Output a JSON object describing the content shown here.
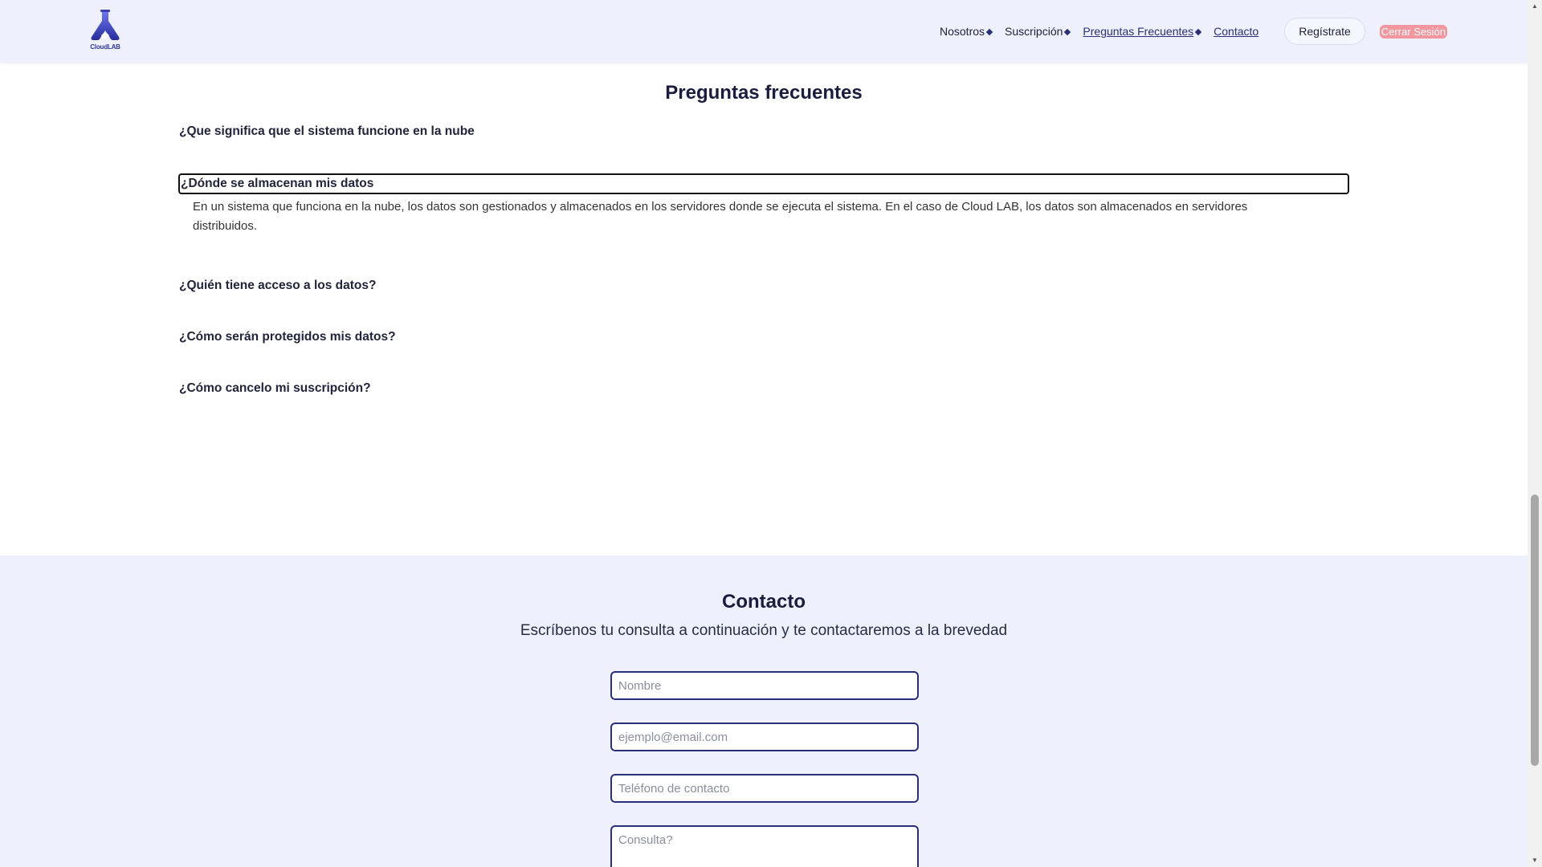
{
  "header": {
    "logo_text": "CloudLAB",
    "nav": [
      {
        "label": "Nosotros",
        "has_diamond": true
      },
      {
        "label": "Suscripción",
        "has_diamond": true
      },
      {
        "label": "Preguntas Frecuentes",
        "has_diamond": true
      },
      {
        "label": "Contacto",
        "has_diamond": false
      }
    ],
    "register_label": "Regístrate",
    "logout_label": "Cerrar Sesión"
  },
  "faq": {
    "title": "Preguntas frecuentes",
    "questions": [
      "¿Que significa que el sistema funcione en la nube",
      "¿Dónde se almacenan mis datos",
      "¿Quién tiene acceso a los datos?",
      "¿Cómo serán protegidos mis datos?",
      "¿Cómo cancelo mi suscripción?"
    ],
    "active_answer": "En un sistema que funciona en la nube, los datos son gestionados y almacenados en los servidores donde se ejecuta el sistema. En el caso de Cloud LAB, los datos son almacenados en servidores distribuidos."
  },
  "contact": {
    "title": "Contacto",
    "subtitle": "Escríbenos tu consulta a continuación y te contactaremos a la brevedad",
    "name_placeholder": "Nombre",
    "email_placeholder": "ejemplo@email.com",
    "phone_placeholder": "Teléfono de contacto",
    "query_placeholder": "Consulta?"
  },
  "colors": {
    "header_bg": "#eef1fd",
    "accent": "#2a2f7a",
    "logout_bg": "#f3969e"
  },
  "icons": {
    "logo": "flask-logo-icon",
    "nav_marker": "diamond-icon"
  }
}
